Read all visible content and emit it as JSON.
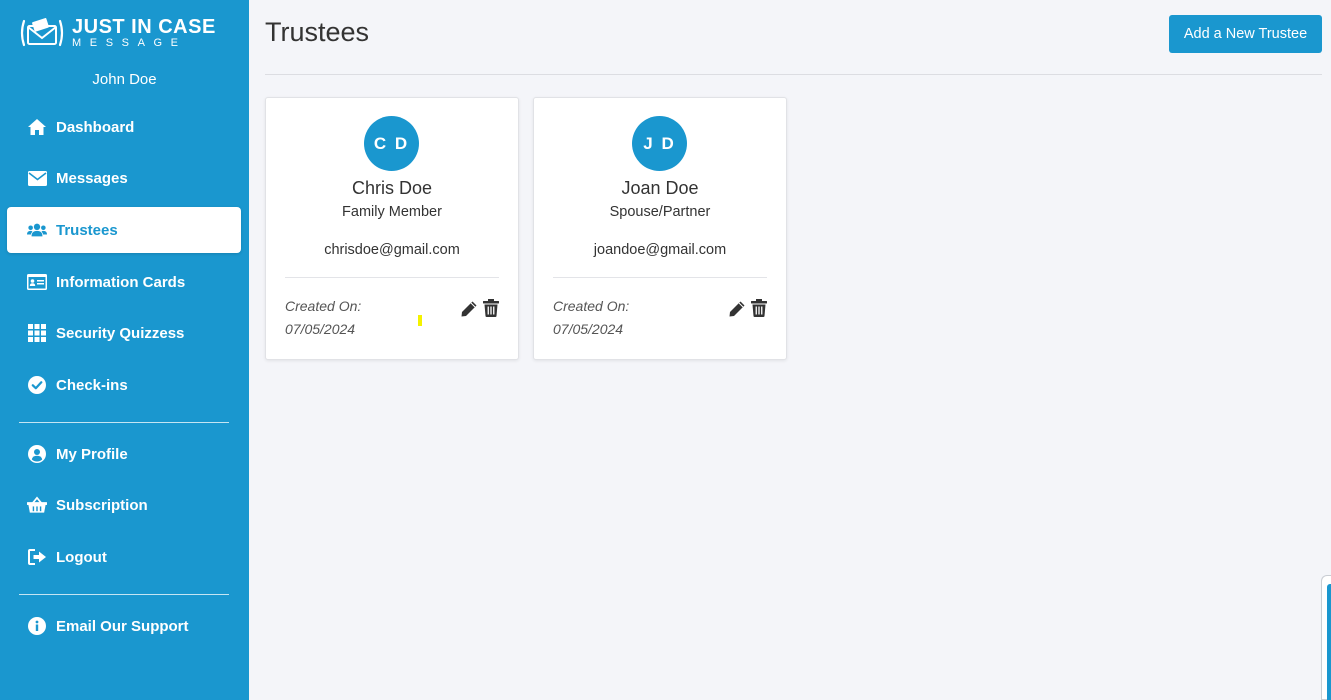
{
  "app": {
    "logo_main": "JUST IN CASE",
    "logo_sub": "MESSAGE",
    "user_name": "John Doe"
  },
  "sidebar": {
    "items": [
      {
        "label": "Dashboard",
        "icon": "home-icon"
      },
      {
        "label": "Messages",
        "icon": "envelope-icon"
      },
      {
        "label": "Trustees",
        "icon": "users-icon",
        "active": true
      },
      {
        "label": "Information Cards",
        "icon": "id-card-icon"
      },
      {
        "label": "Security Quizzess",
        "icon": "grid-icon"
      },
      {
        "label": "Check-ins",
        "icon": "check-circle-icon"
      },
      {
        "label": "My Profile",
        "icon": "user-circle-icon"
      },
      {
        "label": "Subscription",
        "icon": "basket-icon"
      },
      {
        "label": "Logout",
        "icon": "logout-icon"
      },
      {
        "label": "Email Our Support",
        "icon": "info-circle-icon"
      }
    ]
  },
  "main": {
    "title": "Trustees",
    "add_button": "Add a New Trustee",
    "trustees": [
      {
        "initials": "C D",
        "name": "Chris Doe",
        "relationship": "Family Member",
        "email": "chrisdoe@gmail.com",
        "created_label": "Created On:",
        "created_date": "07/05/2024"
      },
      {
        "initials": "J D",
        "name": "Joan Doe",
        "relationship": "Spouse/Partner",
        "email": "joandoe@gmail.com",
        "created_label": "Created On:",
        "created_date": "07/05/2024"
      }
    ]
  },
  "colors": {
    "primary": "#1a97cf",
    "background": "#f4f5f9",
    "card": "#ffffff",
    "text": "#333333"
  }
}
